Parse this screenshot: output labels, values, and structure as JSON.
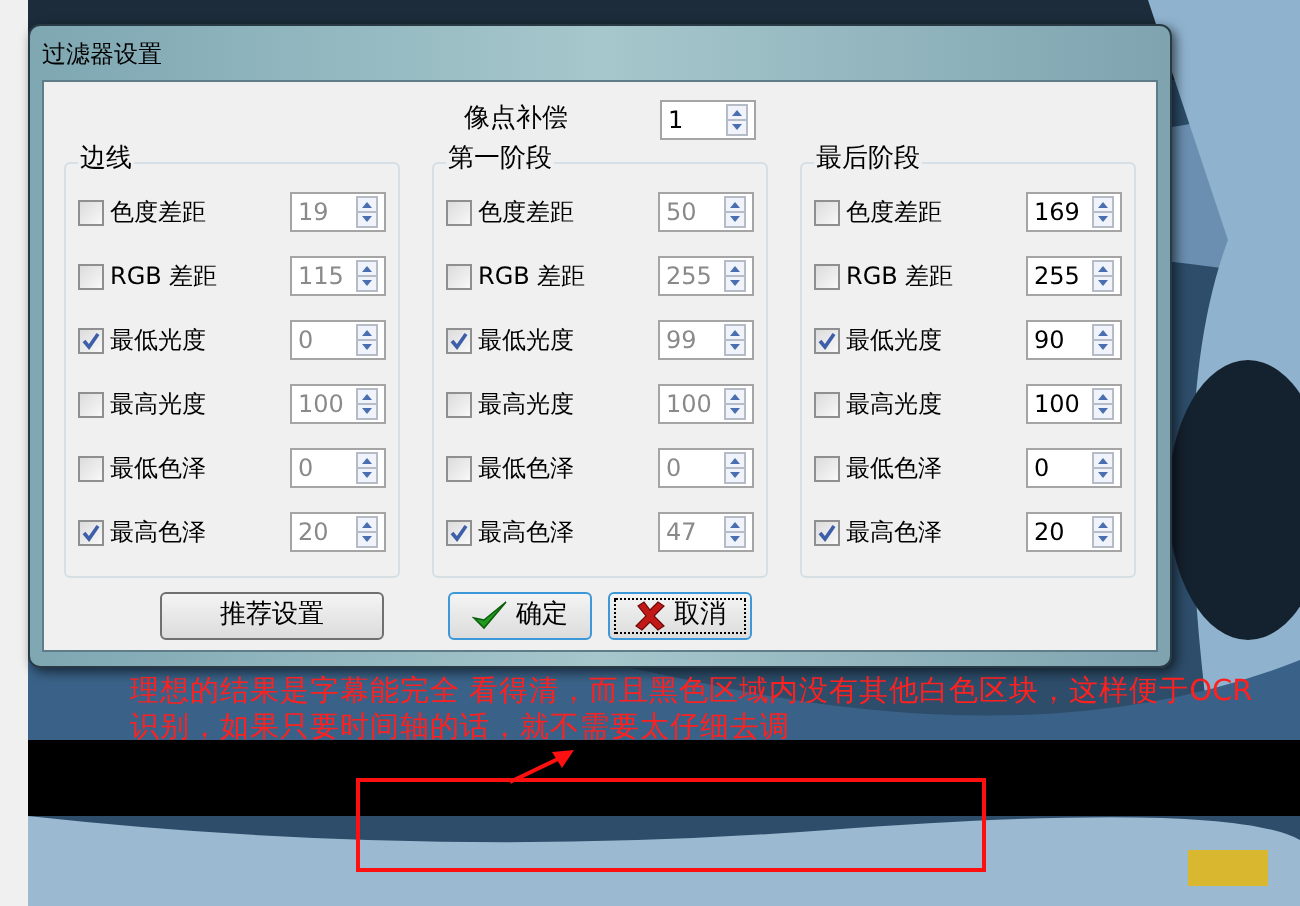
{
  "dialog": {
    "title": "过滤器设置",
    "pixel_compensation": {
      "label": "像点补偿",
      "value": "1"
    },
    "groups": [
      {
        "title": "边线",
        "disabled": true,
        "rows": [
          {
            "label": "色度差距",
            "checked": false,
            "value": "19"
          },
          {
            "label": "RGB 差距",
            "checked": false,
            "value": "115"
          },
          {
            "label": "最低光度",
            "checked": true,
            "value": "0"
          },
          {
            "label": "最高光度",
            "checked": false,
            "value": "100"
          },
          {
            "label": "最低色泽",
            "checked": false,
            "value": "0"
          },
          {
            "label": "最高色泽",
            "checked": true,
            "value": "20"
          }
        ]
      },
      {
        "title": "第一阶段",
        "disabled": true,
        "rows": [
          {
            "label": "色度差距",
            "checked": false,
            "value": "50"
          },
          {
            "label": "RGB 差距",
            "checked": false,
            "value": "255"
          },
          {
            "label": "最低光度",
            "checked": true,
            "value": "99"
          },
          {
            "label": "最高光度",
            "checked": false,
            "value": "100"
          },
          {
            "label": "最低色泽",
            "checked": false,
            "value": "0"
          },
          {
            "label": "最高色泽",
            "checked": true,
            "value": "47"
          }
        ]
      },
      {
        "title": "最后阶段",
        "disabled": false,
        "rows": [
          {
            "label": "色度差距",
            "checked": false,
            "value": "169"
          },
          {
            "label": "RGB 差距",
            "checked": false,
            "value": "255"
          },
          {
            "label": "最低光度",
            "checked": true,
            "value": "90"
          },
          {
            "label": "最高光度",
            "checked": false,
            "value": "100"
          },
          {
            "label": "最低色泽",
            "checked": false,
            "value": "0"
          },
          {
            "label": "最高色泽",
            "checked": true,
            "value": "20"
          }
        ]
      }
    ],
    "buttons": [
      {
        "label": "推荐设置",
        "kind": "plain"
      },
      {
        "label": "确定",
        "kind": "ok"
      },
      {
        "label": "取消",
        "kind": "cancel"
      }
    ]
  },
  "annotation": {
    "text": "理想的结果是字幕能完全 看得清，而且黑色区域内没有其他白色区块，这样便于OCR识别，如果只要时间轴的话，就不需要太仔细去调"
  }
}
